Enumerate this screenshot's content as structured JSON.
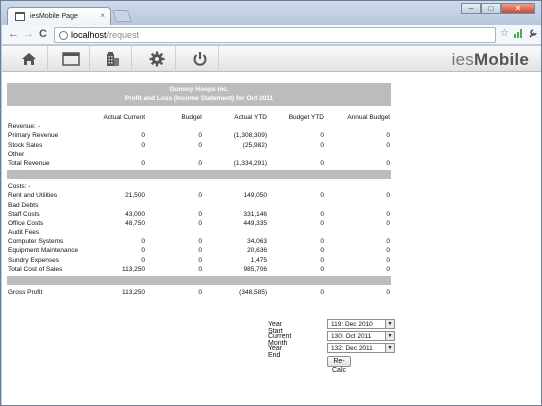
{
  "browser": {
    "tab_title": "iesMobile Page",
    "tab_close": "×",
    "url_host": "localhost",
    "url_path": "/request",
    "window_buttons": [
      "–",
      "□",
      "✕"
    ],
    "nav": {
      "back": "←",
      "forward": "→",
      "reload": "C"
    },
    "toolbar_icons": [
      "star-icon",
      "signal-icon",
      "wrench-icon"
    ]
  },
  "app": {
    "brand_prefix": "ies",
    "brand_suffix": "Mobile",
    "icons": [
      "home-icon",
      "window-icon",
      "building-icon",
      "gear-icon",
      "power-icon"
    ]
  },
  "report": {
    "company": "Gummy Hoops Inc.",
    "title": "Profit and Loss (Income Statement) for Oct 2011",
    "columns": [
      "Actual Current",
      "Budget",
      "Actual YTD",
      "Budget YTD",
      "Annual Budget"
    ],
    "revenue_heading": "Revenue: -",
    "revenue_rows": [
      {
        "label": "Primary Revenue",
        "values": [
          "0",
          "0",
          "(1,308,309)",
          "0",
          "0"
        ]
      },
      {
        "label": "Stock Sales",
        "values": [
          "0",
          "0",
          "(25,982)",
          "0",
          "0"
        ]
      },
      {
        "label": "Other",
        "values": [
          "",
          "",
          "",
          "",
          ""
        ]
      },
      {
        "label": "Total Revenue",
        "values": [
          "0",
          "0",
          "(1,334,291)",
          "0",
          "0"
        ]
      }
    ],
    "costs_heading": "Costs: -",
    "cost_rows": [
      {
        "label": "Rent and Utilities",
        "values": [
          "21,500",
          "0",
          "149,050",
          "0",
          "0"
        ]
      },
      {
        "label": "Bad Debts",
        "values": [
          "",
          "",
          "",
          "",
          ""
        ]
      },
      {
        "label": "Staff Costs",
        "values": [
          "43,000",
          "0",
          "331,146",
          "0",
          "0"
        ]
      },
      {
        "label": "Office Costs",
        "values": [
          "48,750",
          "0",
          "449,335",
          "0",
          "0"
        ]
      },
      {
        "label": "Audit Fees",
        "values": [
          "",
          "",
          "",
          "",
          ""
        ]
      },
      {
        "label": "Computer Systems",
        "values": [
          "0",
          "0",
          "34,063",
          "0",
          "0"
        ]
      },
      {
        "label": "Equipment Maintenance",
        "values": [
          "0",
          "0",
          "20,636",
          "0",
          "0"
        ]
      },
      {
        "label": "Sundry Expenses",
        "values": [
          "0",
          "0",
          "1,475",
          "0",
          "0"
        ]
      },
      {
        "label": "Total Cost of Sales",
        "values": [
          "113,250",
          "0",
          "985,706",
          "0",
          "0"
        ]
      }
    ],
    "gross_profit": {
      "label": "Gross Profit",
      "values": [
        "113,250",
        "0",
        "(348,585)",
        "0",
        "0"
      ]
    }
  },
  "form": {
    "year_start_label": "Year Start",
    "year_start_value": "119: Dec 2010",
    "current_month_label": "Current Month",
    "current_month_value": "130: Oct 2011",
    "year_end_label": "Year End",
    "year_end_value": "132: Dec 2011",
    "recalc_label": "Re-Calc"
  }
}
